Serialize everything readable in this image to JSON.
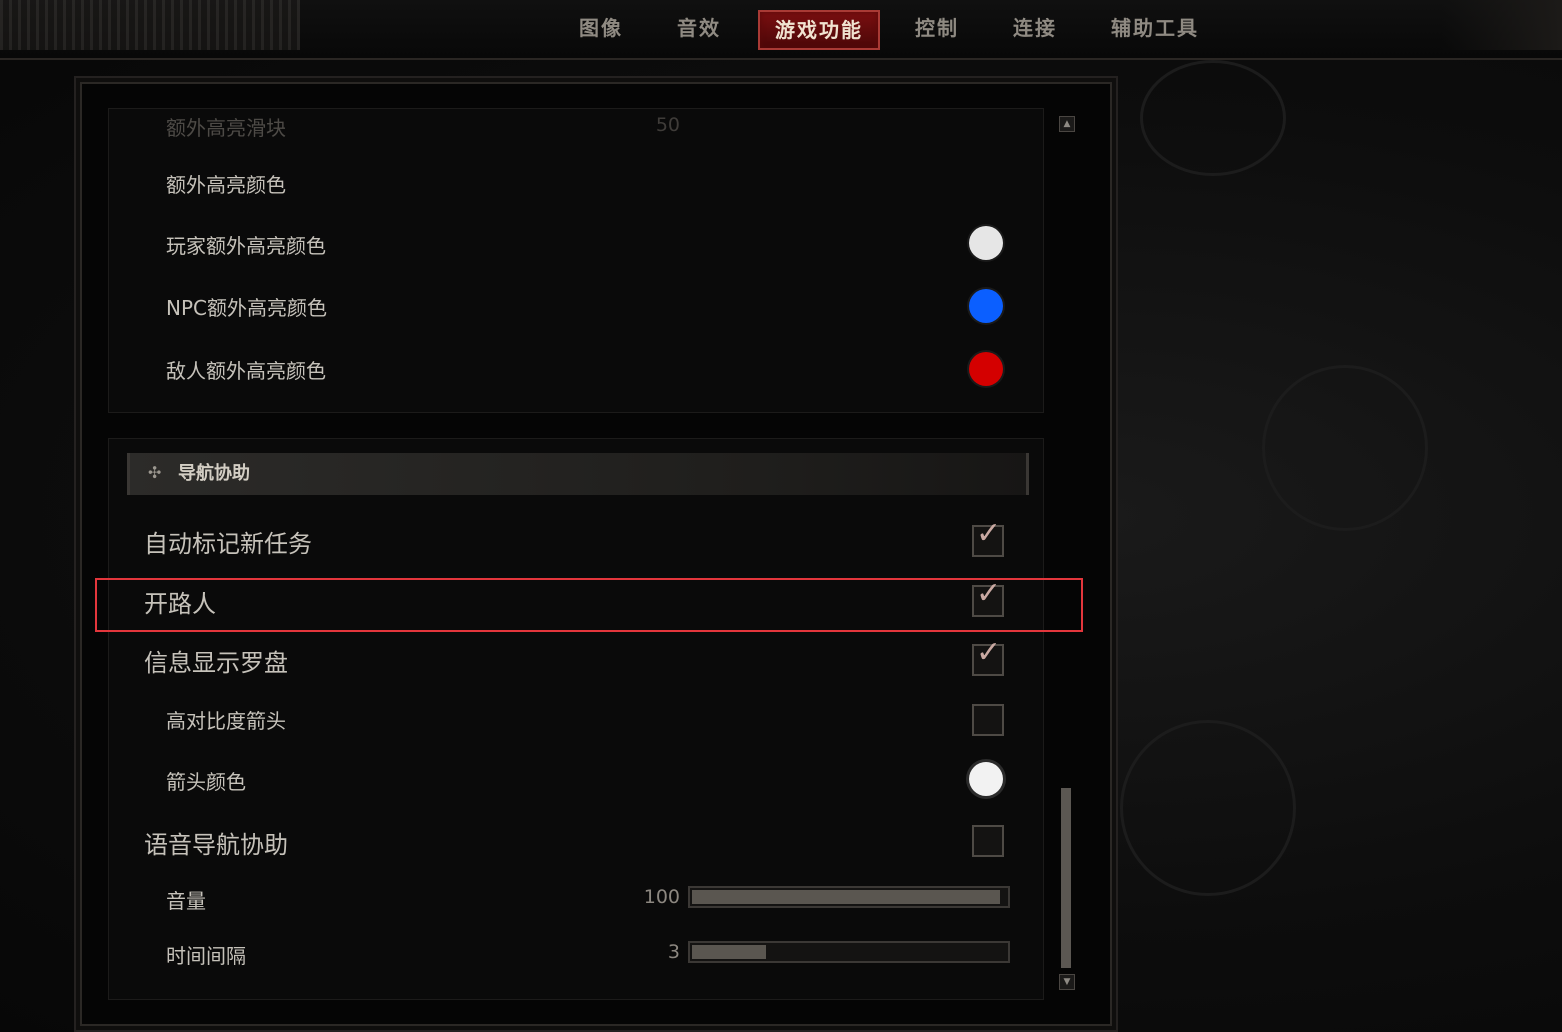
{
  "tabs": [
    {
      "label": "图像",
      "active": false
    },
    {
      "label": "音效",
      "active": false
    },
    {
      "label": "游戏功能",
      "active": true
    },
    {
      "label": "控制",
      "active": false
    },
    {
      "label": "连接",
      "active": false
    },
    {
      "label": "辅助工具",
      "active": false
    }
  ],
  "highlight_section": {
    "partial_row": {
      "label": "额外高亮滑块",
      "value": "50"
    },
    "rows": [
      {
        "label": "额外高亮颜色"
      },
      {
        "label": "玩家额外高亮颜色",
        "color": "#e6e6e6"
      },
      {
        "label": "NPC额外高亮颜色",
        "color": "#0b5fff"
      },
      {
        "label": "敌人额外高亮颜色",
        "color": "#d40000"
      }
    ]
  },
  "navigation": {
    "title": "导航协助",
    "rows": [
      {
        "label": "自动标记新任务",
        "checked": true
      },
      {
        "label": "开路人",
        "checked": true
      },
      {
        "label": "信息显示罗盘",
        "checked": true
      },
      {
        "label": "高对比度箭头",
        "checked": false
      },
      {
        "label": "箭头颜色",
        "color": "#f2f2f2"
      },
      {
        "label": "语音导航协助",
        "checked": false
      },
      {
        "label": "音量",
        "value": "100",
        "fraction": 1.0
      },
      {
        "label": "时间间隔",
        "value": "3",
        "fraction": 0.24
      }
    ]
  },
  "icons": {
    "check": "✓",
    "section": "diamond-cross-icon",
    "scroll_up": "▲",
    "scroll_down": "▼"
  },
  "colors": {
    "accent": "#7a0f10",
    "highlight_box": "#e3363c"
  }
}
